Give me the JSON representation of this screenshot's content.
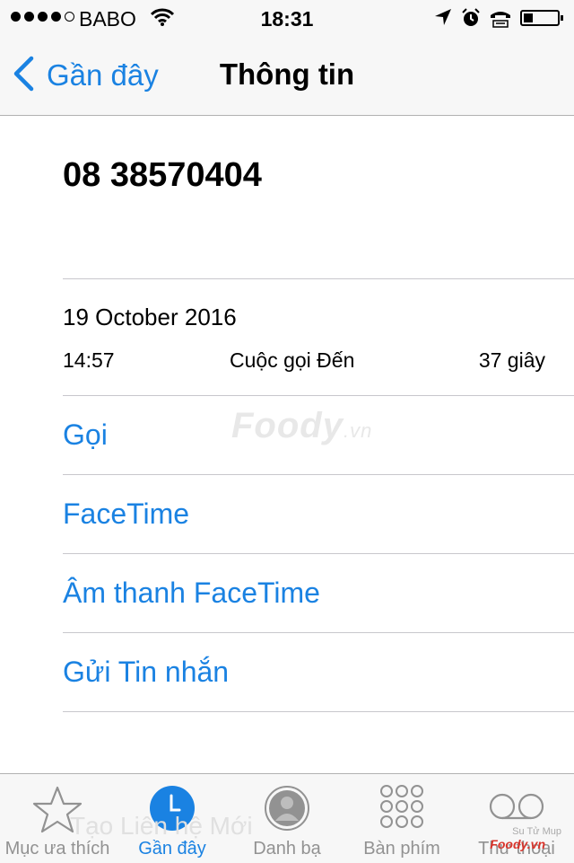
{
  "status_bar": {
    "carrier": "BABO",
    "time": "18:31",
    "icons": [
      "signal-dots",
      "wifi-icon",
      "location-arrow-icon",
      "alarm-icon",
      "tty-icon",
      "battery-icon"
    ]
  },
  "nav": {
    "back_label": "Gần đây",
    "title": "Thông tin"
  },
  "contact": {
    "phone_number": "08 38570404"
  },
  "call_log": {
    "date": "19 October 2016",
    "time": "14:57",
    "type": "Cuộc gọi Đến",
    "duration": "37 giây"
  },
  "actions": [
    "Gọi",
    "FaceTime",
    "Âm thanh FaceTime",
    "Gửi Tin nhắn"
  ],
  "watermark": {
    "brand": "Foody",
    "suffix": ".vn",
    "ghost_text": "Tạo Liên hệ Mới",
    "credit": "Su Tử Mup",
    "credit_logo": "Foody.vn"
  },
  "tabs": [
    {
      "label": "Mục ưa thích",
      "icon": "star-icon",
      "active": false
    },
    {
      "label": "Gần đây",
      "icon": "clock-icon",
      "active": true
    },
    {
      "label": "Danh bạ",
      "icon": "contact-icon",
      "active": false
    },
    {
      "label": "Bàn phím",
      "icon": "keypad-icon",
      "active": false
    },
    {
      "label": "Thư thoại",
      "icon": "voicemail-icon",
      "active": false
    }
  ],
  "colors": {
    "accent": "#1a82e2",
    "inactive_tab": "#929292",
    "separator": "#c8c7cc",
    "bar_background": "#f7f7f7"
  }
}
